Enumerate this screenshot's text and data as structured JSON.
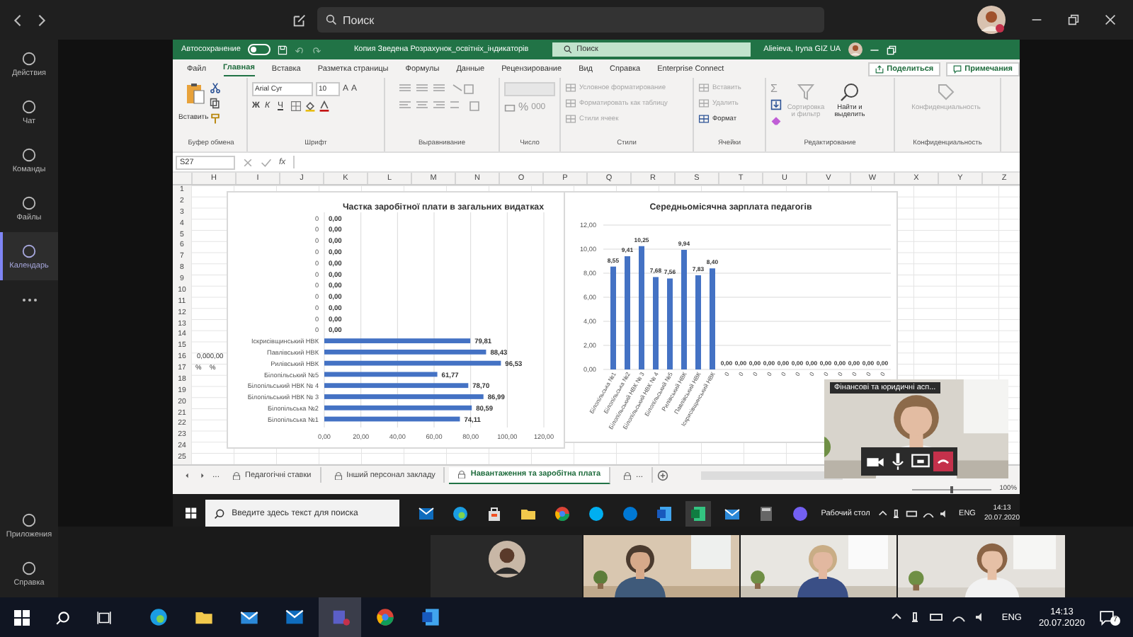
{
  "teams": {
    "search": {
      "placeholder": "Поиск"
    }
  },
  "rail": {
    "items": [
      {
        "label": "Действия",
        "selected": false
      },
      {
        "label": "Чат",
        "selected": false
      },
      {
        "label": "Команды",
        "selected": false
      },
      {
        "label": "Файлы",
        "selected": false
      },
      {
        "label": "Календарь",
        "selected": true
      }
    ],
    "bottom": [
      "Приложения",
      "Справка"
    ]
  },
  "excel": {
    "autosave_label": "Автосохранение",
    "autosave_on": false,
    "title": "Копия Зведена Розрахунок_освітніх_індикаторів",
    "search": {
      "placeholder": "Поиск"
    },
    "user": "Alieieva, Iryna GIZ UA",
    "tabs": [
      {
        "label": "Файл",
        "selected": false
      },
      {
        "label": "Главная",
        "selected": true
      },
      {
        "label": "Вставка",
        "selected": false
      },
      {
        "label": "Разметка страницы",
        "selected": false
      },
      {
        "label": "Формулы",
        "selected": false
      },
      {
        "label": "Данные",
        "selected": false
      },
      {
        "label": "Рецензирование",
        "selected": false
      },
      {
        "label": "Вид",
        "selected": false
      },
      {
        "label": "Справка",
        "selected": false
      },
      {
        "label": "Enterprise Connect",
        "selected": false
      }
    ],
    "share": "Поделиться",
    "comments": "Примечания",
    "ribbon": [
      {
        "kind": "clipboard",
        "label": "Буфер обмена",
        "items": [
          {
            "kind": "big",
            "text": "Вставить",
            "disabled": false
          }
        ]
      },
      {
        "kind": "font",
        "label": "Шрифт",
        "items": [
          {
            "kind": "field",
            "text": "Arial Cyr",
            "disabled": false
          },
          {
            "kind": "field",
            "text": "10",
            "disabled": false
          }
        ],
        "size_buttons": [
          "A",
          "A"
        ],
        "style_buttons": [
          "Ж",
          "К",
          "Ч"
        ]
      },
      {
        "kind": "alignment",
        "label": "Выравнивание"
      },
      {
        "kind": "number",
        "label": "Число",
        "symbols": [
          "%",
          "000"
        ]
      },
      {
        "kind": "styles",
        "label": "Стили",
        "items": [
          {
            "kind": "small",
            "text": "Условное форматирование",
            "disabled": true
          },
          {
            "kind": "small",
            "text": "Форматировать как таблицу",
            "disabled": true
          },
          {
            "kind": "small",
            "text": "Стили ячеек",
            "disabled": true
          }
        ]
      },
      {
        "kind": "cells",
        "label": "Ячейки",
        "items": [
          {
            "kind": "small",
            "text": "Вставить",
            "disabled": true
          },
          {
            "kind": "small",
            "text": "Удалить",
            "disabled": true
          },
          {
            "kind": "small",
            "text": "Формат",
            "disabled": false
          }
        ]
      },
      {
        "kind": "editing",
        "label": "Редактирование",
        "symbol": "Σ",
        "items": [
          {
            "kind": "big",
            "text": "Сортировка и фильтр",
            "disabled": true
          },
          {
            "kind": "big",
            "text": "Найти и выделить",
            "disabled": false
          }
        ]
      },
      {
        "kind": "sensitivity",
        "label": "Конфиденциальность",
        "items": [
          {
            "kind": "big",
            "text": "Конфиденциальность",
            "disabled": true
          }
        ]
      }
    ],
    "name_box": "S27",
    "fx": "fx",
    "columns": [
      "H",
      "I",
      "J",
      "K",
      "L",
      "M",
      "N",
      "O",
      "P",
      "Q",
      "R",
      "S",
      "T",
      "U",
      "V",
      "W",
      "X",
      "Y",
      "Z"
    ],
    "rows": [
      "1",
      "2",
      "3",
      "4",
      "5",
      "6",
      "7",
      "8",
      "9",
      "10",
      "11",
      "12",
      "13",
      "14",
      "15",
      "16",
      "17",
      "18",
      "19",
      "20",
      "21",
      "22",
      "23",
      "24",
      "25"
    ],
    "side_cells": [
      {
        "text": "0,000,00"
      },
      {
        "text": "%"
      },
      {
        "text": "%"
      }
    ],
    "charts": [
      {
        "chart_data": {
          "type": "bar",
          "orientation": "horizontal",
          "title": "Частка заробітної плати в загальних видатках",
          "categories": [
            "0",
            "0",
            "0",
            "0",
            "0",
            "0",
            "0",
            "0",
            "0",
            "0",
            "0",
            "Іскрисівщинський НВК",
            "Павлівський НВК",
            "Рилівський НВК",
            "Білопільський №5",
            "Білопільський НВК № 4",
            "Білопільський НВК № 3",
            "Білопільська №2",
            "Білопільська №1"
          ],
          "values": [
            0,
            0,
            0,
            0,
            0,
            0,
            0,
            0,
            0,
            0,
            0,
            79.81,
            88.43,
            96.53,
            61.77,
            78.7,
            86.99,
            80.59,
            74.11
          ],
          "value_labels": [
            "0,00",
            "0,00",
            "0,00",
            "0,00",
            "0,00",
            "0,00",
            "0,00",
            "0,00",
            "0,00",
            "0,00",
            "0,00",
            "79,81",
            "88,43",
            "96,53",
            "61,77",
            "78,70",
            "86,99",
            "80,59",
            "74,11"
          ],
          "xlim": [
            0,
            120
          ],
          "grid": true,
          "xticks": [
            {
              "value": 0,
              "label": "0,00"
            },
            {
              "value": 20,
              "label": "20,00"
            },
            {
              "value": 40,
              "label": "40,00"
            },
            {
              "value": 60,
              "label": "60,00"
            },
            {
              "value": 80,
              "label": "80,00"
            },
            {
              "value": 100,
              "label": "100,00"
            },
            {
              "value": 120,
              "label": "120,00"
            }
          ]
        }
      },
      {
        "chart_data": {
          "type": "bar",
          "orientation": "vertical",
          "title": "Середньомісячна зарплата педагогів",
          "categories": [
            "Білопільська №1",
            "Білопільська №2",
            "Білопільський НВК № 3",
            "Білопільський НВК № 4",
            "Білопільський №5",
            "Рилівський НВК",
            "Павлівський НВК",
            "Іскрисівщинський НВК",
            "0",
            "0",
            "0",
            "0",
            "0",
            "0",
            "0",
            "0",
            "0",
            "0",
            "0",
            "0"
          ],
          "values": [
            8.55,
            9.41,
            10.25,
            7.68,
            7.56,
            9.94,
            7.83,
            8.4,
            0,
            0,
            0,
            0,
            0,
            0,
            0,
            0,
            0,
            0,
            0,
            0
          ],
          "value_labels": [
            "8,55",
            "9,41",
            "10,25",
            "7,68",
            "7,56",
            "9,94",
            "7,83",
            "8,40",
            "0,00",
            "0,00",
            "0,00",
            "0,00",
            "0,00",
            "0,00",
            "0,00",
            "0,00",
            "0,00",
            "0,00",
            "0,00",
            "0,00"
          ],
          "ylim": [
            0,
            12
          ],
          "grid": true,
          "yticks": [
            {
              "value": 12,
              "label": "12,00"
            },
            {
              "value": 10,
              "label": "10,00"
            },
            {
              "value": 8,
              "label": "8,00"
            },
            {
              "value": 6,
              "label": "6,00"
            },
            {
              "value": 4,
              "label": "4,00"
            },
            {
              "value": 2,
              "label": "2,00"
            },
            {
              "value": 0,
              "label": "0,00"
            }
          ]
        }
      }
    ],
    "sheet_tabs": [
      {
        "label": "Педагогічні ставки",
        "selected": false
      },
      {
        "label": "Інший персонал закладу",
        "selected": false
      },
      {
        "label": "Навантаження та заробітна плата",
        "selected": true
      }
    ],
    "sheet_more": [
      "...",
      "..."
    ],
    "zoom_slider": {
      "level": 0.5
    },
    "zoom": "100%"
  },
  "desktop_taskbar": {
    "search": {
      "placeholder": "Введите здесь текст для поиска"
    },
    "desktop_label": "Рабочий стол",
    "lang": "ENG",
    "time": "14:13",
    "date": "20.07.2020"
  },
  "meeting_popup": {
    "title": "Фінансові та юридичні асп..."
  },
  "video_tiles": [
    {
      "kind": "avatar"
    },
    {
      "kind": "picture"
    },
    {
      "kind": "picture"
    },
    {
      "kind": "picture"
    }
  ],
  "taskbar": {
    "lang": "ENG",
    "time": "14:13",
    "date": "20.07.2020",
    "notifications": "7"
  }
}
